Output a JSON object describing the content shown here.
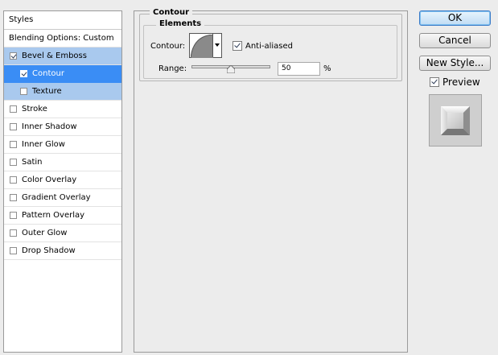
{
  "styles_panel": {
    "header": "Styles",
    "blending_options": "Blending Options: Custom",
    "items": [
      {
        "label": "Bevel & Emboss",
        "checked": true
      },
      {
        "label": "Contour",
        "checked": true
      },
      {
        "label": "Texture",
        "checked": false
      },
      {
        "label": "Stroke",
        "checked": false
      },
      {
        "label": "Inner Shadow",
        "checked": false
      },
      {
        "label": "Inner Glow",
        "checked": false
      },
      {
        "label": "Satin",
        "checked": false
      },
      {
        "label": "Color Overlay",
        "checked": false
      },
      {
        "label": "Gradient Overlay",
        "checked": false
      },
      {
        "label": "Pattern Overlay",
        "checked": false
      },
      {
        "label": "Outer Glow",
        "checked": false
      },
      {
        "label": "Drop Shadow",
        "checked": false
      }
    ]
  },
  "contour_section": {
    "title": "Contour",
    "elements_title": "Elements",
    "contour_label": "Contour:",
    "anti_aliased_label": "Anti-aliased",
    "anti_aliased_checked": true,
    "range_label": "Range:",
    "range_value": "50",
    "range_unit": "%",
    "range_fraction": 0.5
  },
  "buttons": {
    "ok": "OK",
    "cancel": "Cancel",
    "new_style": "New Style..."
  },
  "preview": {
    "label": "Preview",
    "checked": true
  },
  "colors": {
    "selected_row": "#3a8df5",
    "selected_parent_row": "#a9c9ee"
  }
}
